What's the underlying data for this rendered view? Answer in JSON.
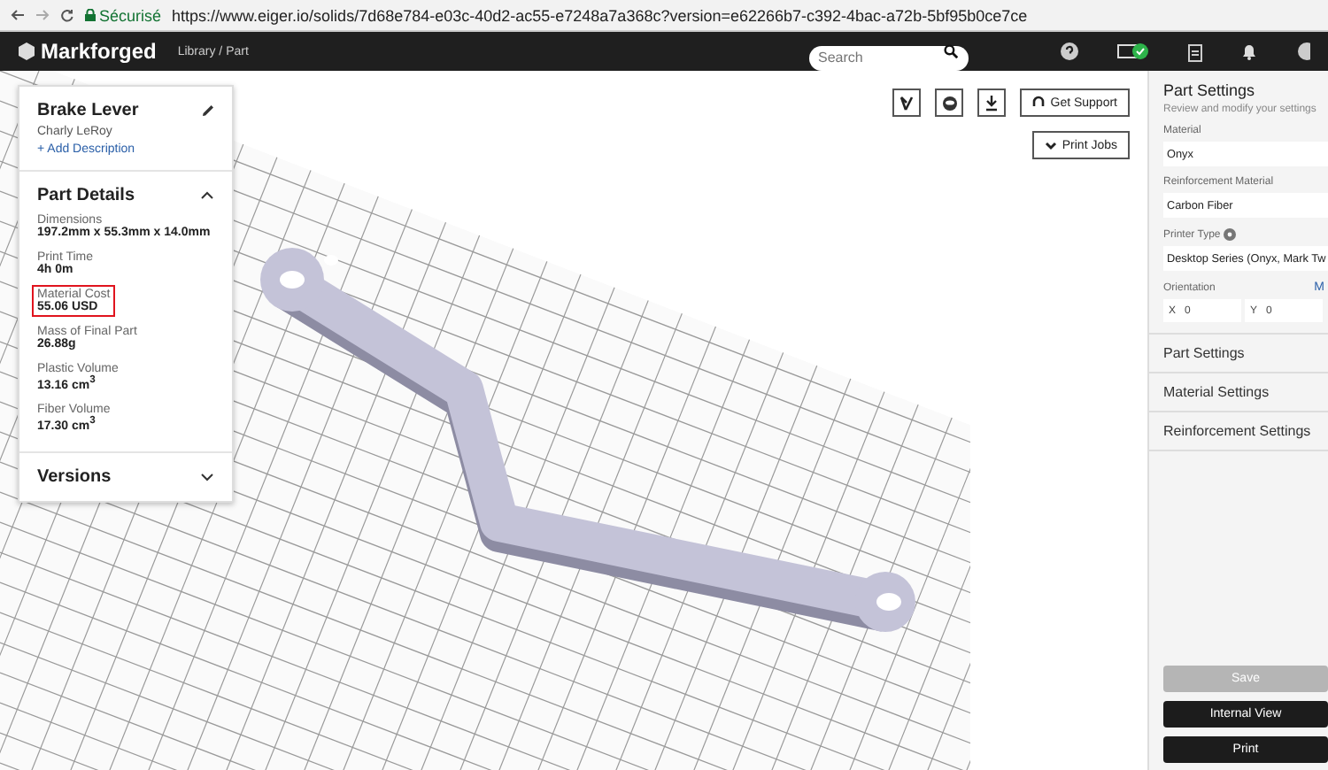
{
  "browser": {
    "secure_label": "Sécurisé",
    "url": "https://www.eiger.io/solids/7d68e784-e03c-40d2-ac55-e7248a7a368c?version=e62266b7-c392-4bac-a72b-5bf95b0ce7ce"
  },
  "header": {
    "logo": "Markforged",
    "breadcrumb": "Library / Part",
    "search": {
      "placeholder": "Search"
    }
  },
  "part_card": {
    "title": "Brake Lever",
    "author": "Charly LeRoy",
    "add_description": "+ Add Description",
    "details_title": "Part Details",
    "details_expanded": true,
    "details": [
      {
        "label": "Dimensions",
        "value": "197.2mm x 55.3mm x 14.0mm",
        "highlighted": false
      },
      {
        "label": "Print Time",
        "value": "4h 0m",
        "highlighted": false
      },
      {
        "label": "Material Cost",
        "value": "55.06 USD",
        "highlighted": true
      },
      {
        "label": "Mass of Final Part",
        "value": "26.88g",
        "highlighted": false
      },
      {
        "label": "Plastic Volume",
        "value": "13.16 cm$^{3}$",
        "highlighted": false
      },
      {
        "label": "Fiber Volume",
        "value": "17.30 cm$^{3}$",
        "highlighted": false
      }
    ],
    "versions_title": "Versions",
    "versions_expanded": false
  },
  "toolbar": {
    "support": "Get Support",
    "print_jobs": "Print Jobs"
  },
  "settings": {
    "title": "Part Settings",
    "subtitle": "Review and modify your settings",
    "fields": [
      {
        "label": "Material",
        "value": "Onyx"
      },
      {
        "label": "Reinforcement Material",
        "value": "Carbon Fiber"
      },
      {
        "label": "Printer Type",
        "value": "Desktop Series (Onyx, Mark Tw"
      }
    ],
    "orientation": {
      "label": "Orientation",
      "link": "M",
      "axes": [
        {
          "axis": "X",
          "value": "0"
        },
        {
          "axis": "Y",
          "value": "0"
        }
      ]
    },
    "sections": [
      "Part Settings",
      "Material Settings",
      "Reinforcement Settings"
    ],
    "buttons": [
      {
        "label": "Save",
        "disabled": true
      },
      {
        "label": "Internal View",
        "disabled": false
      },
      {
        "label": "Print",
        "disabled": false
      }
    ]
  }
}
